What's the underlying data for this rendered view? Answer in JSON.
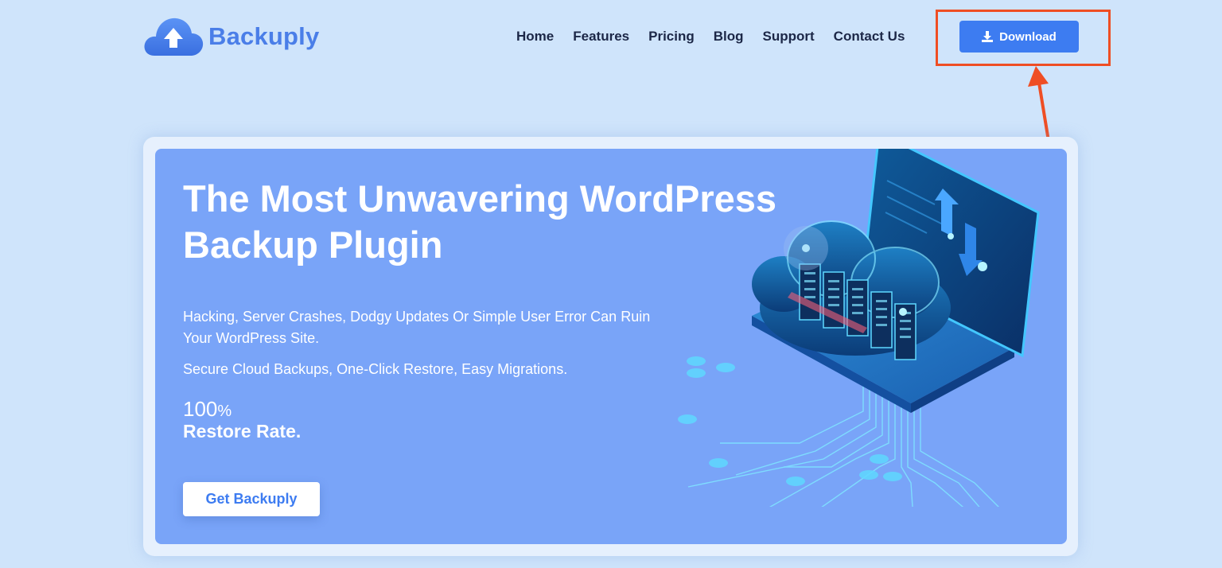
{
  "header": {
    "logo_text": "Backuply",
    "nav": [
      "Home",
      "Features",
      "Pricing",
      "Blog",
      "Support",
      "Contact Us"
    ],
    "download_label": "Download"
  },
  "hero": {
    "title": "The Most Unwavering WordPress Backup Plugin",
    "subtitle": "Hacking, Server Crashes, Dodgy Updates Or Simple User Error Can Ruin Your WordPress Site.",
    "subtitle2": "Secure Cloud Backups, One-Click Restore, Easy Migrations.",
    "stat_value": "100",
    "stat_unit": "%",
    "stat_label": "Restore Rate.",
    "cta_label": "Get Backuply"
  },
  "colors": {
    "background": "#cfe4fb",
    "accent": "#3d7cf1",
    "hero_bg": "#79a4f8",
    "annotation": "#ef4e24",
    "nav_text": "#1c2747"
  }
}
